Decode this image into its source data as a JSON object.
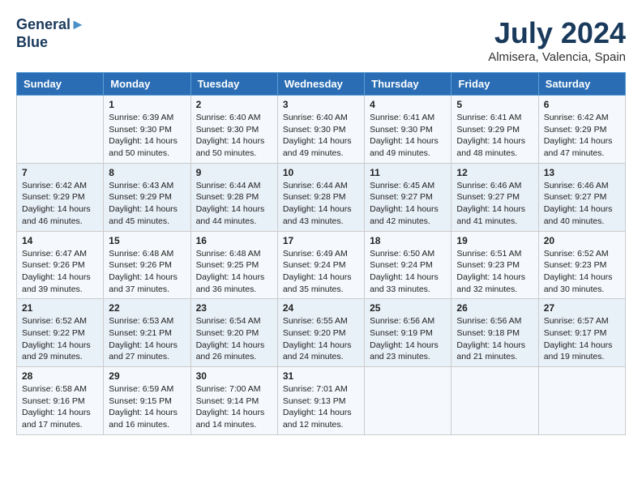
{
  "logo": {
    "line1": "General",
    "line2": "Blue"
  },
  "title": {
    "month_year": "July 2024",
    "location": "Almisera, Valencia, Spain"
  },
  "headers": [
    "Sunday",
    "Monday",
    "Tuesday",
    "Wednesday",
    "Thursday",
    "Friday",
    "Saturday"
  ],
  "weeks": [
    [
      {
        "day": "",
        "info": ""
      },
      {
        "day": "1",
        "info": "Sunrise: 6:39 AM\nSunset: 9:30 PM\nDaylight: 14 hours\nand 50 minutes."
      },
      {
        "day": "2",
        "info": "Sunrise: 6:40 AM\nSunset: 9:30 PM\nDaylight: 14 hours\nand 50 minutes."
      },
      {
        "day": "3",
        "info": "Sunrise: 6:40 AM\nSunset: 9:30 PM\nDaylight: 14 hours\nand 49 minutes."
      },
      {
        "day": "4",
        "info": "Sunrise: 6:41 AM\nSunset: 9:30 PM\nDaylight: 14 hours\nand 49 minutes."
      },
      {
        "day": "5",
        "info": "Sunrise: 6:41 AM\nSunset: 9:29 PM\nDaylight: 14 hours\nand 48 minutes."
      },
      {
        "day": "6",
        "info": "Sunrise: 6:42 AM\nSunset: 9:29 PM\nDaylight: 14 hours\nand 47 minutes."
      }
    ],
    [
      {
        "day": "7",
        "info": "Sunrise: 6:42 AM\nSunset: 9:29 PM\nDaylight: 14 hours\nand 46 minutes."
      },
      {
        "day": "8",
        "info": "Sunrise: 6:43 AM\nSunset: 9:29 PM\nDaylight: 14 hours\nand 45 minutes."
      },
      {
        "day": "9",
        "info": "Sunrise: 6:44 AM\nSunset: 9:28 PM\nDaylight: 14 hours\nand 44 minutes."
      },
      {
        "day": "10",
        "info": "Sunrise: 6:44 AM\nSunset: 9:28 PM\nDaylight: 14 hours\nand 43 minutes."
      },
      {
        "day": "11",
        "info": "Sunrise: 6:45 AM\nSunset: 9:27 PM\nDaylight: 14 hours\nand 42 minutes."
      },
      {
        "day": "12",
        "info": "Sunrise: 6:46 AM\nSunset: 9:27 PM\nDaylight: 14 hours\nand 41 minutes."
      },
      {
        "day": "13",
        "info": "Sunrise: 6:46 AM\nSunset: 9:27 PM\nDaylight: 14 hours\nand 40 minutes."
      }
    ],
    [
      {
        "day": "14",
        "info": "Sunrise: 6:47 AM\nSunset: 9:26 PM\nDaylight: 14 hours\nand 39 minutes."
      },
      {
        "day": "15",
        "info": "Sunrise: 6:48 AM\nSunset: 9:26 PM\nDaylight: 14 hours\nand 37 minutes."
      },
      {
        "day": "16",
        "info": "Sunrise: 6:48 AM\nSunset: 9:25 PM\nDaylight: 14 hours\nand 36 minutes."
      },
      {
        "day": "17",
        "info": "Sunrise: 6:49 AM\nSunset: 9:24 PM\nDaylight: 14 hours\nand 35 minutes."
      },
      {
        "day": "18",
        "info": "Sunrise: 6:50 AM\nSunset: 9:24 PM\nDaylight: 14 hours\nand 33 minutes."
      },
      {
        "day": "19",
        "info": "Sunrise: 6:51 AM\nSunset: 9:23 PM\nDaylight: 14 hours\nand 32 minutes."
      },
      {
        "day": "20",
        "info": "Sunrise: 6:52 AM\nSunset: 9:23 PM\nDaylight: 14 hours\nand 30 minutes."
      }
    ],
    [
      {
        "day": "21",
        "info": "Sunrise: 6:52 AM\nSunset: 9:22 PM\nDaylight: 14 hours\nand 29 minutes."
      },
      {
        "day": "22",
        "info": "Sunrise: 6:53 AM\nSunset: 9:21 PM\nDaylight: 14 hours\nand 27 minutes."
      },
      {
        "day": "23",
        "info": "Sunrise: 6:54 AM\nSunset: 9:20 PM\nDaylight: 14 hours\nand 26 minutes."
      },
      {
        "day": "24",
        "info": "Sunrise: 6:55 AM\nSunset: 9:20 PM\nDaylight: 14 hours\nand 24 minutes."
      },
      {
        "day": "25",
        "info": "Sunrise: 6:56 AM\nSunset: 9:19 PM\nDaylight: 14 hours\nand 23 minutes."
      },
      {
        "day": "26",
        "info": "Sunrise: 6:56 AM\nSunset: 9:18 PM\nDaylight: 14 hours\nand 21 minutes."
      },
      {
        "day": "27",
        "info": "Sunrise: 6:57 AM\nSunset: 9:17 PM\nDaylight: 14 hours\nand 19 minutes."
      }
    ],
    [
      {
        "day": "28",
        "info": "Sunrise: 6:58 AM\nSunset: 9:16 PM\nDaylight: 14 hours\nand 17 minutes."
      },
      {
        "day": "29",
        "info": "Sunrise: 6:59 AM\nSunset: 9:15 PM\nDaylight: 14 hours\nand 16 minutes."
      },
      {
        "day": "30",
        "info": "Sunrise: 7:00 AM\nSunset: 9:14 PM\nDaylight: 14 hours\nand 14 minutes."
      },
      {
        "day": "31",
        "info": "Sunrise: 7:01 AM\nSunset: 9:13 PM\nDaylight: 14 hours\nand 12 minutes."
      },
      {
        "day": "",
        "info": ""
      },
      {
        "day": "",
        "info": ""
      },
      {
        "day": "",
        "info": ""
      }
    ]
  ]
}
